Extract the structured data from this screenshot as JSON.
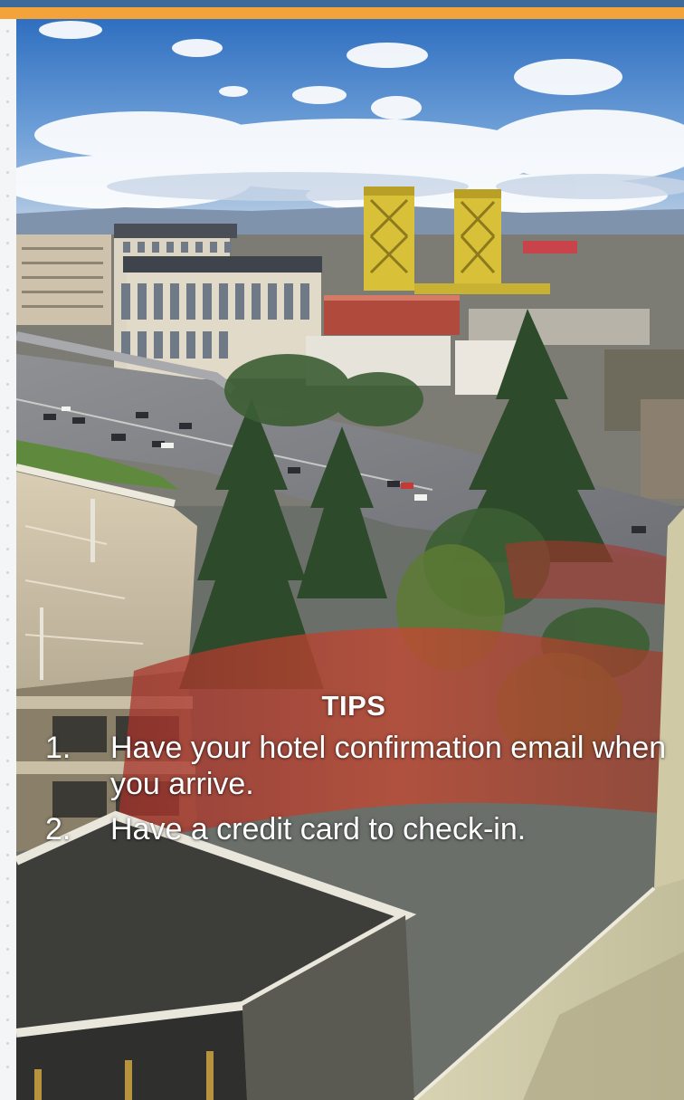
{
  "header": {
    "accent_color": "#f3a33a",
    "top_color": "#3d6a9a"
  },
  "photo": {
    "icon": "city-skyline-photo",
    "subject": "Tower Bridge"
  },
  "tips": {
    "heading": "TIPS",
    "items": [
      {
        "number": "1.",
        "text": "Have your hotel confirmation email when you arrive."
      },
      {
        "number": "2.",
        "text": "Have a credit card to check-in."
      }
    ],
    "text_color": "#ffffff"
  }
}
